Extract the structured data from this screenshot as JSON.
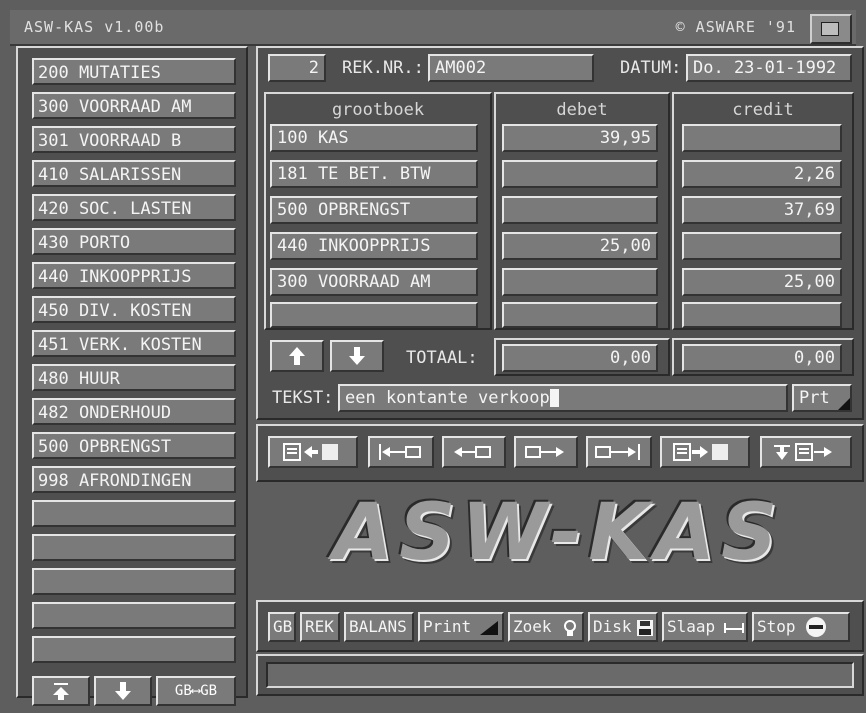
{
  "window": {
    "title": "ASW-KAS v1.00b",
    "copyright": "© ASWARE '91"
  },
  "accounts": [
    "200 MUTATIES",
    "300 VOORRAAD AM",
    "301 VOORRAAD B",
    "410 SALARISSEN",
    "420 SOC. LASTEN",
    "430 PORTO",
    "440 INKOOPPRIJS",
    "450 DIV. KOSTEN",
    "451 VERK. KOSTEN",
    "480 HUUR",
    "482 ONDERHOUD",
    "500 OPBRENGST",
    "998 AFRONDINGEN"
  ],
  "account_nav": {
    "up": "⭱",
    "down": "🡓",
    "swap": "GB⟷GB"
  },
  "header": {
    "entry_no": "2",
    "rek_label": "REK.NR.:",
    "rek_value": "AM002",
    "datum_label": "DATUM:",
    "datum_value": "Do. 23-01-1992"
  },
  "columns": {
    "grootboek": "grootboek",
    "debet": "debet",
    "credit": "credit"
  },
  "rows": [
    {
      "account": "100 KAS",
      "debet": "39,95",
      "credit": ""
    },
    {
      "account": "181 TE BET. BTW",
      "debet": "",
      "credit": "2,26"
    },
    {
      "account": "500 OPBRENGST",
      "debet": "",
      "credit": "37,69"
    },
    {
      "account": "440 INKOOPPRIJS",
      "debet": "25,00",
      "credit": ""
    },
    {
      "account": "300 VOORRAAD AM",
      "debet": "",
      "credit": "25,00"
    },
    {
      "account": "",
      "debet": "",
      "credit": ""
    }
  ],
  "totals": {
    "label": "TOTAAL:",
    "debet": "0,00",
    "credit": "0,00"
  },
  "tekst": {
    "label": "TEKST:",
    "value": "een kontante verkoop",
    "prt": "Prt"
  },
  "logo": "ASW-KAS",
  "menu": {
    "gb": "GB",
    "rek": "REK",
    "balans": "BALANS",
    "print": "Print",
    "zoek": "Zoek",
    "disk": "Disk",
    "slaap": "Slaap",
    "stop": "Stop"
  },
  "colors": {
    "panel": "#4f4f4f",
    "field": "#7a7a7a",
    "highlight": "#e5e5e5",
    "shadow": "#333333",
    "text": "#f4f4f4"
  }
}
